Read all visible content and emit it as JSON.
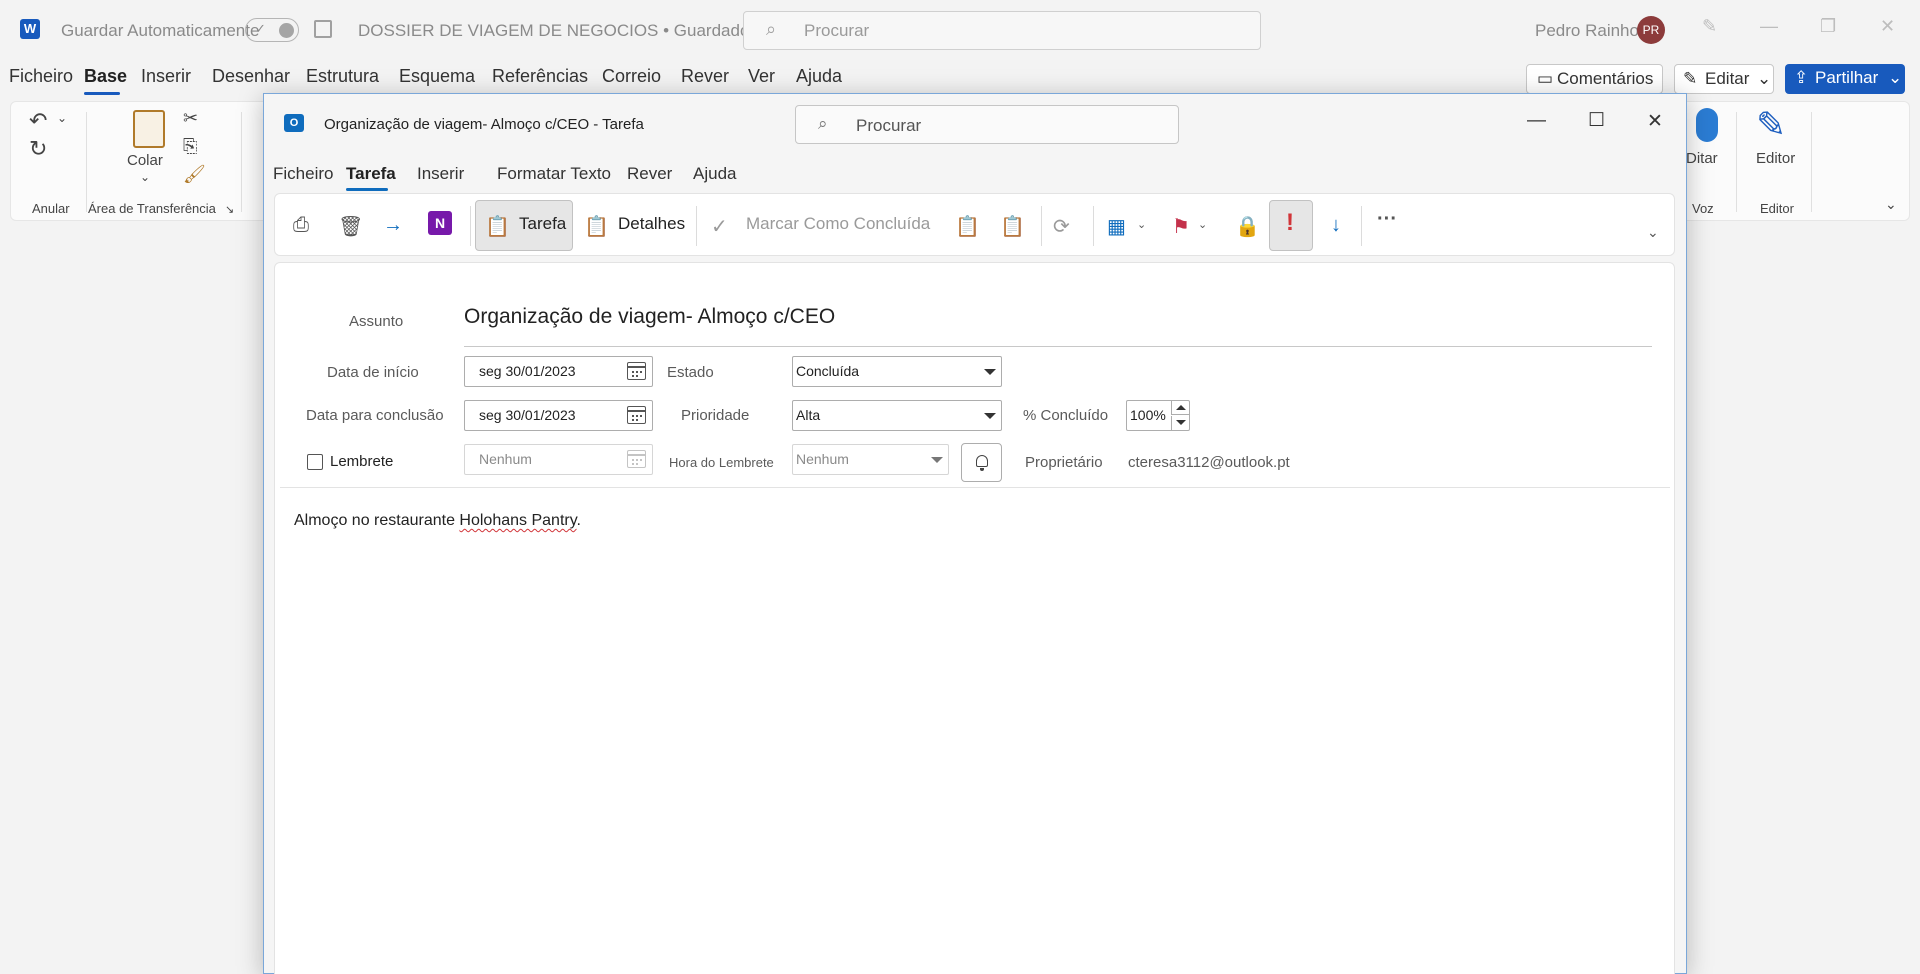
{
  "word": {
    "app_icon": "word-icon",
    "autosave_label": "Guardar Automaticamente",
    "doc_title": "DOSSIER DE VIAGEM DE NEGOCIOS • Guardado",
    "search_placeholder": "Procurar",
    "user_name": "Pedro Rainho",
    "user_initials": "PR",
    "menu": [
      "Ficheiro",
      "Base",
      "Inserir",
      "Desenhar",
      "Estrutura",
      "Esquema",
      "Referências",
      "Correio",
      "Rever",
      "Ver",
      "Ajuda"
    ],
    "active_menu": "Base",
    "comments_label": "Comentários",
    "edit_label": "Editar",
    "share_label": "Partilhar",
    "ribbon": {
      "undo_group": "Anular",
      "paste_label": "Colar",
      "clipboard_group": "Área de Transferência",
      "dictate_label": "Ditar",
      "voice_group": "Voz",
      "editor_label": "Editor",
      "editor_group": "Editor"
    },
    "accent_color": "#185abd"
  },
  "task": {
    "window_title": "Organização de viagem- Almoço c/CEO  -  Tarefa",
    "search_placeholder": "Procurar",
    "menu": [
      "Ficheiro",
      "Tarefa",
      "Inserir",
      "Formatar Texto",
      "Rever",
      "Ajuda"
    ],
    "active_menu": "Tarefa",
    "ribbon": {
      "task_label": "Tarefa",
      "details_label": "Detalhes",
      "mark_complete_label": "Marcar Como Concluída"
    },
    "form": {
      "subject_label": "Assunto",
      "subject_value": "Organização de viagem- Almoço c/CEO",
      "start_label": "Data de início",
      "start_value": "seg 30/01/2023",
      "due_label": "Data para conclusão",
      "due_value": "seg 30/01/2023",
      "status_label": "Estado",
      "status_value": "Concluída",
      "priority_label": "Prioridade",
      "priority_value": "Alta",
      "percent_label": "% Concluído",
      "percent_value": "100%",
      "reminder_label": "Lembrete",
      "reminder_date_value": "Nenhum",
      "reminder_time_label": "Hora do Lembrete",
      "reminder_time_value": "Nenhum",
      "owner_label": "Proprietário",
      "owner_value": "cteresa3112@outlook.pt"
    },
    "body_prefix": "Almoço no restaurante ",
    "body_misspelled": "Holohans Pantry",
    "body_suffix": ".",
    "accent_color": "#0f6cbd",
    "high_importance_color": "#d13438"
  }
}
